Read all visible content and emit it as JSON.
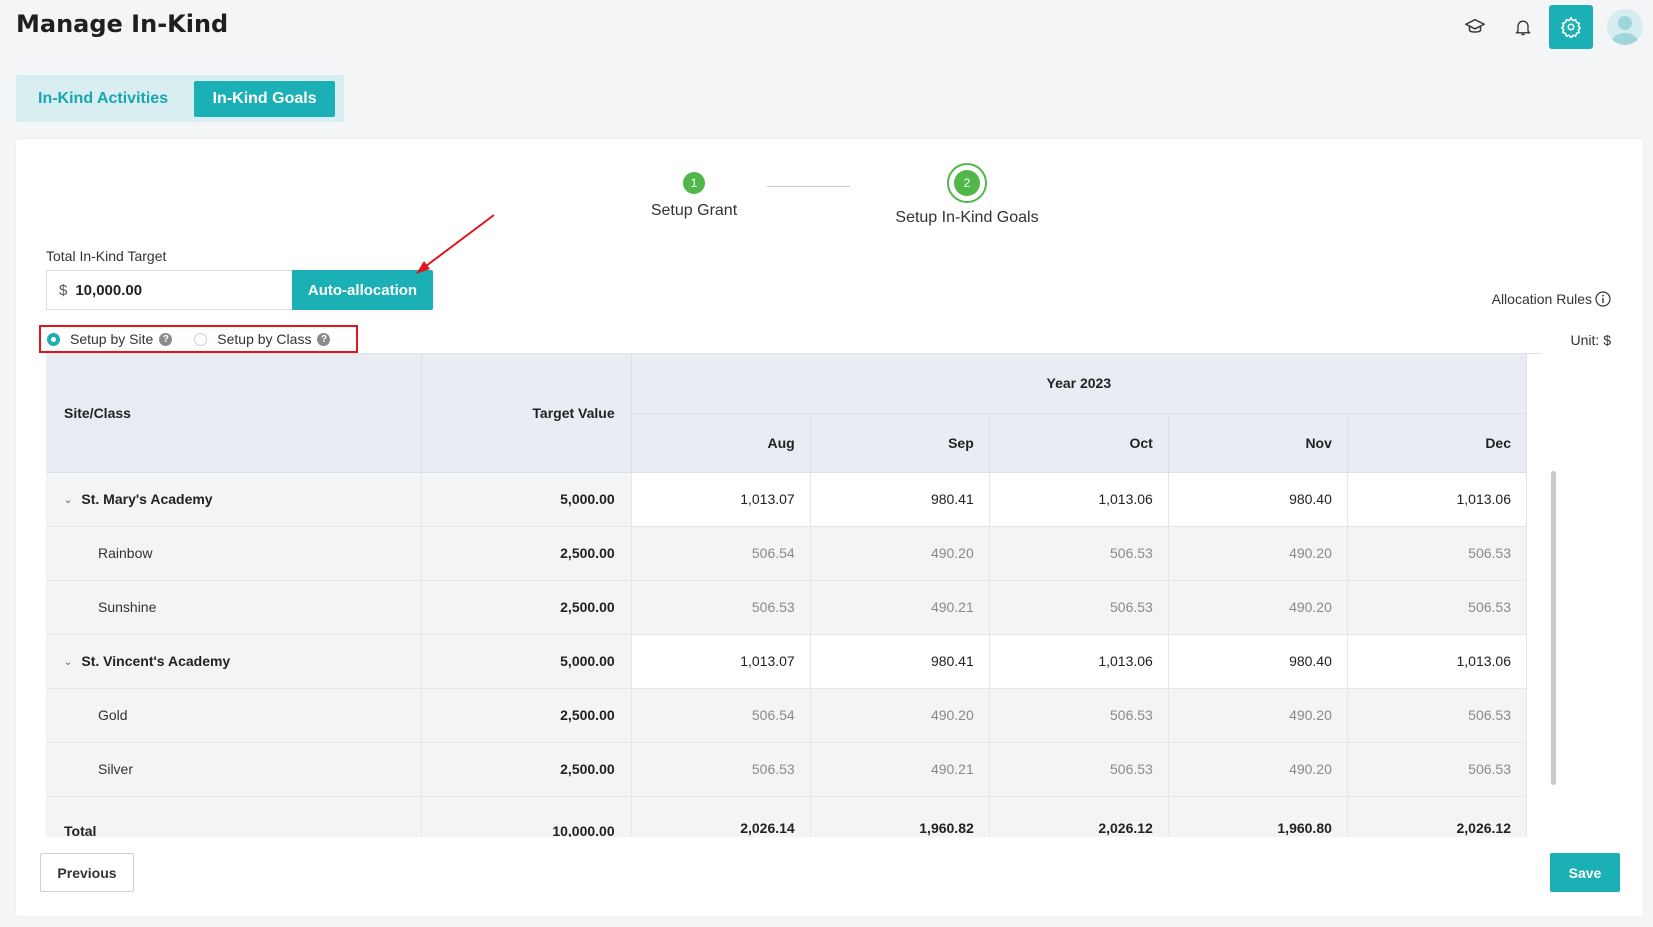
{
  "page": {
    "title": "Manage In-Kind"
  },
  "header_icons": [
    "graduation-cap-icon",
    "bell-icon",
    "gear-icon",
    "user-avatar"
  ],
  "tabs": [
    {
      "label": "In-Kind Activities",
      "active": false
    },
    {
      "label": "In-Kind Goals",
      "active": true
    }
  ],
  "steps": [
    {
      "number": "1",
      "label": "Setup Grant",
      "status": "completed"
    },
    {
      "number": "2",
      "label": "Setup In-Kind Goals",
      "status": "current"
    }
  ],
  "target": {
    "label": "Total In-Kind Target",
    "currency": "$",
    "value": "10,000.00",
    "auto_button": "Auto-allocation"
  },
  "allocation_rules": "Allocation Rules",
  "unit": "Unit: $",
  "setup_options": [
    {
      "label": "Setup by Site",
      "selected": true
    },
    {
      "label": "Setup by Class",
      "selected": false
    }
  ],
  "table": {
    "col_site": "Site/Class",
    "col_target": "Target Value",
    "year_label": "Year 2023",
    "months": [
      "Aug",
      "Sep",
      "Oct",
      "Nov",
      "Dec"
    ],
    "rows": [
      {
        "type": "site",
        "name": "St. Mary's Academy",
        "target": "5,000.00",
        "values": [
          "1,013.07",
          "980.41",
          "1,013.06",
          "980.40",
          "1,013.06"
        ]
      },
      {
        "type": "class",
        "name": "Rainbow",
        "target": "2,500.00",
        "values": [
          "506.54",
          "490.20",
          "506.53",
          "490.20",
          "506.53"
        ]
      },
      {
        "type": "class",
        "name": "Sunshine",
        "target": "2,500.00",
        "values": [
          "506.53",
          "490.21",
          "506.53",
          "490.20",
          "506.53"
        ]
      },
      {
        "type": "site",
        "name": "St. Vincent's Academy",
        "target": "5,000.00",
        "values": [
          "1,013.07",
          "980.41",
          "1,013.06",
          "980.40",
          "1,013.06"
        ]
      },
      {
        "type": "class",
        "name": "Gold",
        "target": "2,500.00",
        "values": [
          "506.54",
          "490.20",
          "506.53",
          "490.20",
          "506.53"
        ]
      },
      {
        "type": "class",
        "name": "Silver",
        "target": "2,500.00",
        "values": [
          "506.53",
          "490.21",
          "506.53",
          "490.20",
          "506.53"
        ]
      }
    ],
    "total": {
      "label": "Total",
      "target": "10,000.00",
      "values": [
        "2,026.14",
        "1,960.82",
        "2,026.12",
        "1,960.80",
        "2,026.12"
      ]
    }
  },
  "buttons": {
    "previous": "Previous",
    "save": "Save"
  },
  "colors": {
    "accent": "#1bb0b5",
    "step_green": "#50b748",
    "highlight_red": "#e0161c"
  }
}
